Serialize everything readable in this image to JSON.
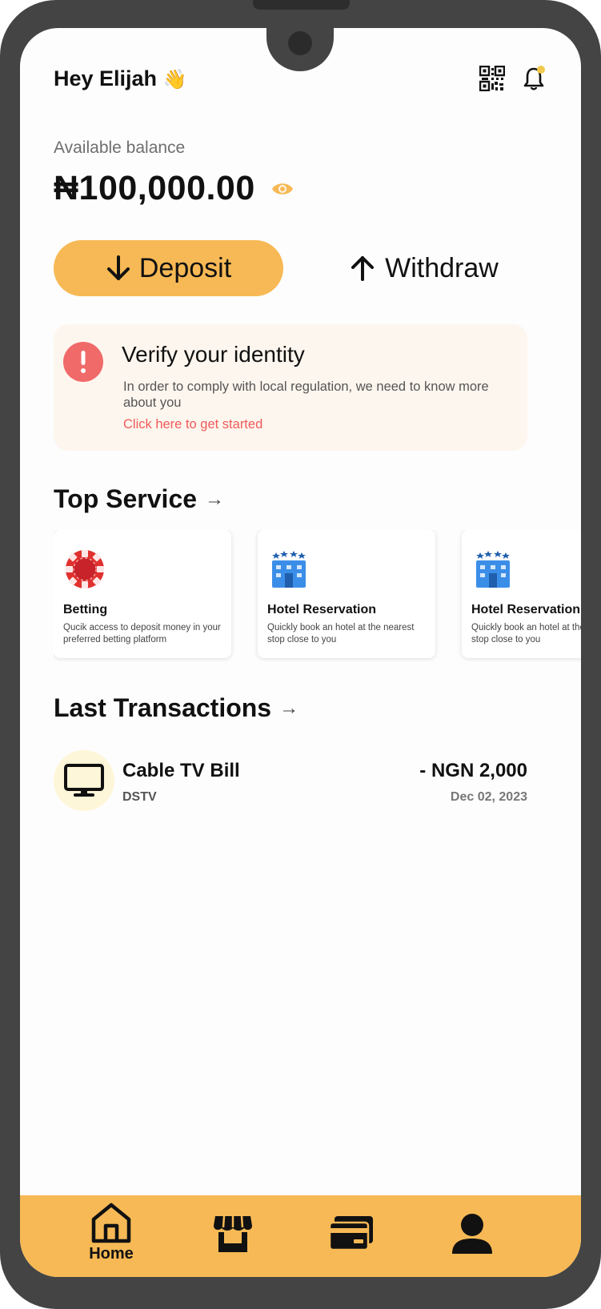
{
  "header": {
    "greeting": "Hey Elijah",
    "greeting_emoji": "👋",
    "qr_icon": "qr-code-icon",
    "notification_icon": "bell-icon",
    "notification_dot_color": "#f2c94c"
  },
  "balance": {
    "label": "Available balance",
    "amount": "₦100,000.00",
    "visibility_icon": "eye-icon",
    "eye_color": "#f7b955"
  },
  "actions": {
    "deposit_label": "Deposit",
    "withdraw_label": "Withdraw"
  },
  "verify": {
    "title": "Verify your identity",
    "description": "In order to comply with local regulation, we need to know more about you",
    "link_text": "Click here to get started",
    "alert_color": "#f06a6a",
    "link_color": "#ef5a5a"
  },
  "top_service": {
    "title": "Top Service",
    "arrow": "→",
    "items": [
      {
        "name": "Betting",
        "description": "Qucik access to deposit money in your preferred betting platform",
        "icon": "betting-chip-icon"
      },
      {
        "name": "Hotel Reservation",
        "description": "Quickly book an hotel at the nearest stop close to you",
        "icon": "hotel-icon"
      },
      {
        "name": "Hotel Reservation",
        "description": "Quickly book an hotel at the nearest stop close to you",
        "icon": "hotel-icon"
      }
    ]
  },
  "transactions": {
    "title": "Last Transactions",
    "arrow": "→",
    "items": [
      {
        "title": "Cable TV Bill",
        "subtitle": "DSTV",
        "amount": "- NGN 2,000",
        "date": "Dec 02, 2023",
        "icon": "tv-icon"
      }
    ]
  },
  "bottom_nav": {
    "background": "#f7b955",
    "items": [
      {
        "label": "Home",
        "icon": "home-icon",
        "active": true
      },
      {
        "label": "",
        "icon": "store-icon",
        "active": false
      },
      {
        "label": "",
        "icon": "card-icon",
        "active": false
      },
      {
        "label": "",
        "icon": "profile-icon",
        "active": false
      }
    ]
  }
}
